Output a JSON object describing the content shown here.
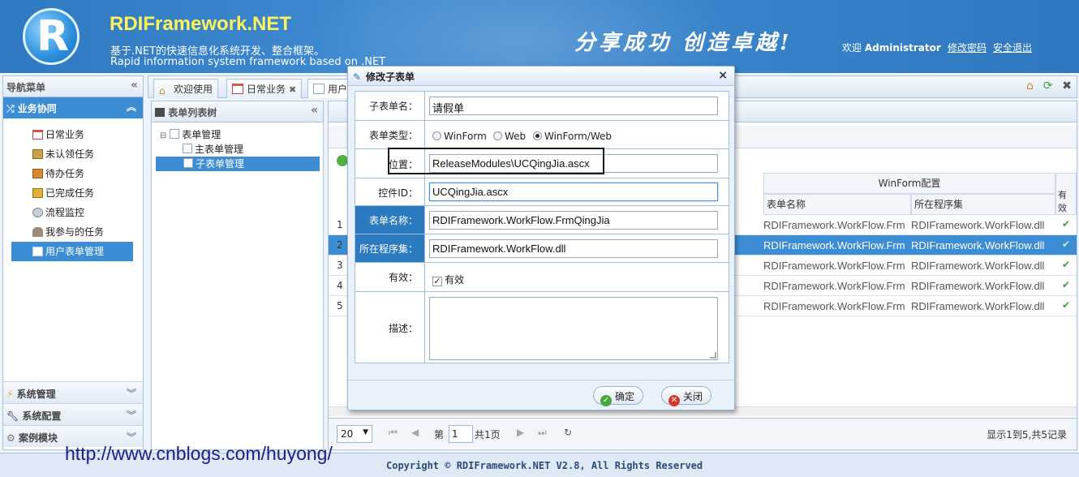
{
  "header": {
    "brand": "RDIFramework.NET",
    "subtitle_cn": "基于.NET的快速信息化系统开发、整合框架。",
    "subtitle_en": "Rapid information system framework based on .NET",
    "slogan": "分享成功  创造卓越!",
    "welcome_prefix": "欢迎",
    "user": "Administrator",
    "change_password": "修改密码",
    "logout": "安全退出"
  },
  "leftnav": {
    "title": "导航菜单",
    "active_group": "业务协同",
    "items": [
      {
        "label": "日常业务",
        "icon": "calendar-icon",
        "color": "#d9534f"
      },
      {
        "label": "未认领任务",
        "icon": "inbox-icon",
        "color": "#c9a24a"
      },
      {
        "label": "待办任务",
        "icon": "briefcase-icon",
        "color": "#d78a2f"
      },
      {
        "label": "已完成任务",
        "icon": "box-icon",
        "color": "#e0b13a"
      },
      {
        "label": "流程监控",
        "icon": "eye-icon",
        "color": "#7a8896"
      },
      {
        "label": "我参与的任务",
        "icon": "user-icon",
        "color": "#7c6a5a"
      },
      {
        "label": "用户表单管理",
        "icon": "form-icon",
        "color": "#ffffff"
      }
    ],
    "groups": [
      {
        "label": "系统管理",
        "icon": "lightning-icon"
      },
      {
        "label": "系统配置",
        "icon": "wrench-icon"
      },
      {
        "label": "案例模块",
        "icon": "gear-icon"
      }
    ]
  },
  "tabs": [
    {
      "label": "欢迎使用",
      "icon": "home-icon"
    },
    {
      "label": "日常业务",
      "icon": "calendar-icon"
    },
    {
      "label": "用户",
      "icon": "form-icon"
    }
  ],
  "tree": {
    "title": "表单列表树",
    "root": "表单管理",
    "children": [
      "主表单管理",
      "子表单管理"
    ]
  },
  "grid": {
    "group_header": "WinForm配置",
    "valid_header": "有效",
    "columns": [
      "表单名称",
      "所在程序集"
    ],
    "rows": [
      {
        "num": "1",
        "form": "RDIFramework.WorkFlow.Frm",
        "assembly": "RDIFramework.WorkFlow.dll",
        "valid": "✔"
      },
      {
        "num": "2",
        "form": "RDIFramework.WorkFlow.Frm",
        "assembly": "RDIFramework.WorkFlow.dll",
        "valid": "✔"
      },
      {
        "num": "3",
        "form": "RDIFramework.WorkFlow.Frm",
        "assembly": "RDIFramework.WorkFlow.dll",
        "valid": "✔"
      },
      {
        "num": "4",
        "form": "RDIFramework.WorkFlow.Frm",
        "assembly": "RDIFramework.WorkFlow.dll",
        "valid": "✔"
      },
      {
        "num": "5",
        "form": "RDIFramework.WorkFlow.Frm",
        "assembly": "RDIFramework.WorkFlow.dll",
        "valid": "✔"
      }
    ],
    "selected_row": 2,
    "pager": {
      "page_size": "20",
      "page_prefix": "第",
      "page_value": "1",
      "page_suffix": "共1页",
      "info": "显示1到5,共5记录"
    }
  },
  "dialog": {
    "title": "修改子表单",
    "fields": {
      "name_label": "子表单名：",
      "name_value": "请假单",
      "type_label": "表单类型：",
      "type_options": [
        "WinForm",
        "Web",
        "WinForm/Web"
      ],
      "type_selected": "WinForm/Web",
      "location_label": "位置：",
      "location_value": "ReleaseModules\\UCQingJia.ascx",
      "control_label": "控件ID：",
      "control_value": "UCQingJia.ascx",
      "formname_label": "表单名称：",
      "formname_value": "RDIFramework.WorkFlow.FrmQingJia",
      "assembly_label": "所在程序集：",
      "assembly_value": "RDIFramework.WorkFlow.dll",
      "valid_label": "有效：",
      "valid_checkbox": "有效",
      "desc_label": "描述："
    },
    "ok_label": "确定",
    "close_label": "关闭"
  },
  "footer": {
    "copyright": "Copyright © RDIFramework.NET V2.8, All Rights Reserved",
    "watermark": "http://www.cnblogs.com/huyong/"
  }
}
